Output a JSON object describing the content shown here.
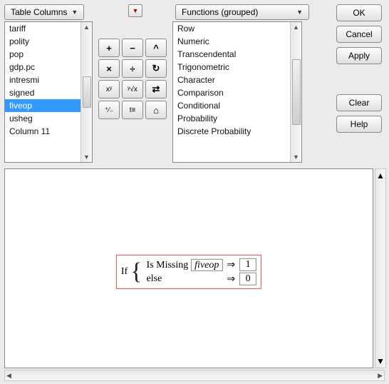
{
  "dropdowns": {
    "table_columns_label": "Table Columns",
    "functions_label": "Functions (grouped)"
  },
  "columns": {
    "items": [
      "tariff",
      "polity",
      "pop",
      "gdp.pc",
      "intresmi",
      "signed",
      "fiveop",
      "usheg",
      "Column 11"
    ],
    "selected_index": 6
  },
  "functions": {
    "items": [
      "Row",
      "Numeric",
      "Transcendental",
      "Trigonometric",
      "Character",
      "Comparison",
      "Conditional",
      "Probability",
      "Discrete Probability"
    ]
  },
  "keypad": {
    "keys": [
      "+",
      "−",
      "^",
      "×",
      "÷",
      "↻",
      "xʸ",
      "ʸ√x",
      "⇄",
      "⁺∕₋",
      "t≡",
      "⌂"
    ]
  },
  "buttons": {
    "ok": "OK",
    "cancel": "Cancel",
    "apply": "Apply",
    "clear": "Clear",
    "help": "Help"
  },
  "formula": {
    "if_label": "If",
    "func_name": "Is Missing",
    "arg": "fiveop",
    "imp": "⇒",
    "then_val": "1",
    "else_label": "else",
    "else_val": "0"
  }
}
